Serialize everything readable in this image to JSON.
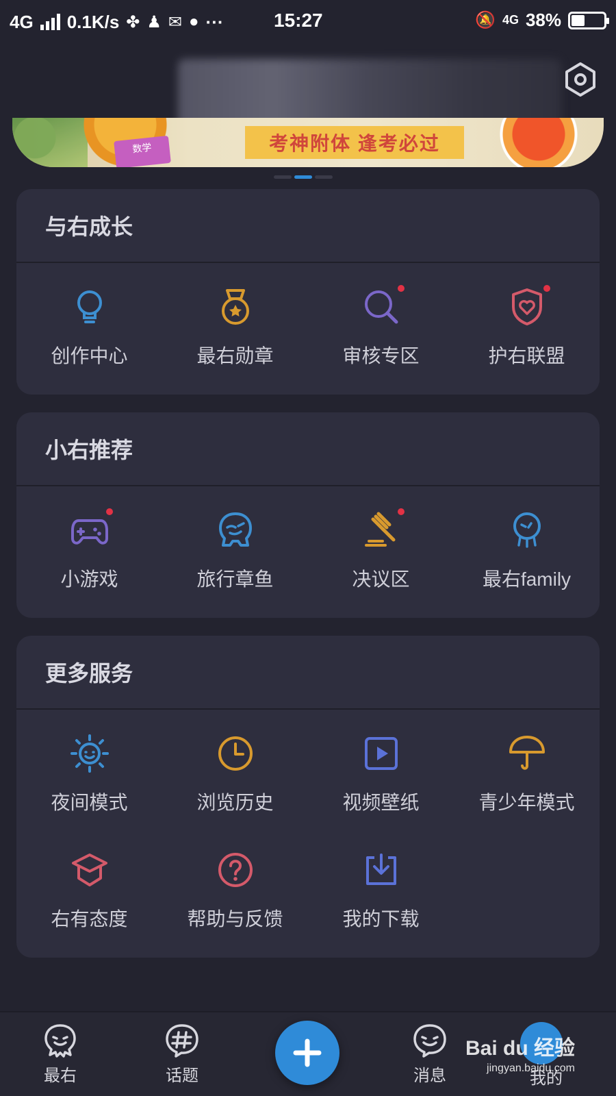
{
  "status_bar": {
    "network": "4G",
    "speed": "0.1K/s",
    "more": "···",
    "time": "15:27",
    "network_right": "4G",
    "battery": "38%"
  },
  "banner": {
    "slogan": "考神附体 逢考必过",
    "book_label": "数学"
  },
  "sections": [
    {
      "title": "与右成长",
      "items": [
        {
          "label": "创作中心",
          "icon": "lightbulb-icon",
          "color": "#3d8fd1",
          "dot": false
        },
        {
          "label": "最右勋章",
          "icon": "medal-icon",
          "color": "#d89a2e",
          "dot": false
        },
        {
          "label": "审核专区",
          "icon": "search-icon",
          "color": "#7b67c9",
          "dot": true
        },
        {
          "label": "护右联盟",
          "icon": "shield-heart-icon",
          "color": "#d45a6a",
          "dot": true
        }
      ]
    },
    {
      "title": "小右推荐",
      "items": [
        {
          "label": "小游戏",
          "icon": "gamepad-icon",
          "color": "#7b67c9",
          "dot": true
        },
        {
          "label": "旅行章鱼",
          "icon": "octopus-icon",
          "color": "#3d8fd1",
          "dot": false
        },
        {
          "label": "决议区",
          "icon": "gavel-icon",
          "color": "#d89a2e",
          "dot": true
        },
        {
          "label": "最右family",
          "icon": "family-icon",
          "color": "#3d8fd1",
          "dot": false
        }
      ]
    },
    {
      "title": "更多服务",
      "items": [
        {
          "label": "夜间模式",
          "icon": "sun-icon",
          "color": "#3d8fd1",
          "dot": false
        },
        {
          "label": "浏览历史",
          "icon": "clock-icon",
          "color": "#d89a2e",
          "dot": false
        },
        {
          "label": "视频壁纸",
          "icon": "video-icon",
          "color": "#5b72d8",
          "dot": false
        },
        {
          "label": "青少年模式",
          "icon": "umbrella-icon",
          "color": "#d89a2e",
          "dot": false
        },
        {
          "label": "右有态度",
          "icon": "graduation-cap-icon",
          "color": "#d45a6a",
          "dot": false
        },
        {
          "label": "帮助与反馈",
          "icon": "help-icon",
          "color": "#d45a6a",
          "dot": false
        },
        {
          "label": "我的下载",
          "icon": "download-icon",
          "color": "#5b72d8",
          "dot": false
        }
      ]
    }
  ],
  "bottom_nav": {
    "home": "最右",
    "topics": "话题",
    "messages": "消息",
    "me": "我的"
  },
  "watermark": {
    "brand": "Bai du 经验",
    "url": "jingyan.baidu.com"
  },
  "colors": {
    "background": "#23232f",
    "card": "#2e2e3e",
    "accent": "#2f8bd8",
    "badge": "#e23245"
  }
}
